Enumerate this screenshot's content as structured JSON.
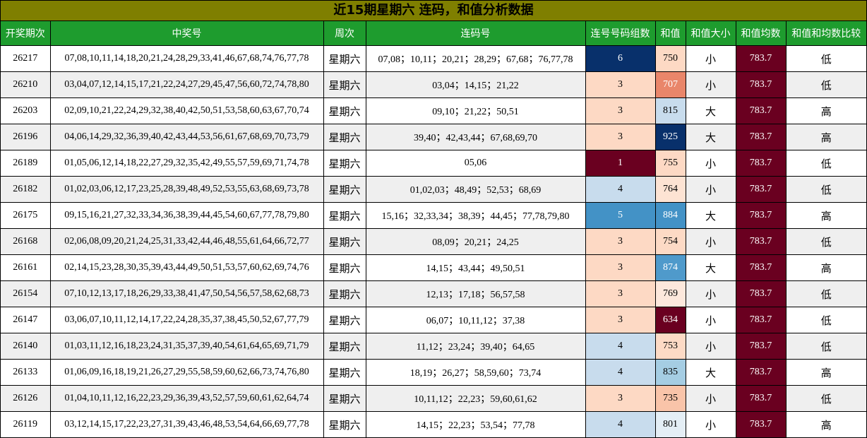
{
  "title": "近15期星期六 连码，和值分析数据",
  "headers": [
    "开奖期次",
    "中奖号",
    "周次",
    "连码号",
    "连号号码组数",
    "和值",
    "和值大小",
    "和值均数",
    "和值和均数比较"
  ],
  "colors": {
    "title_bg": "#7f7f00",
    "header_bg": "#1e9c2e",
    "avg_bg": "#6a0020"
  },
  "rows": [
    {
      "period": "26217",
      "numbers": "07,08,10,11,14,18,20,21,24,28,29,33,41,46,67,68,74,76,77,78",
      "week": "星期六",
      "consecutive": "07,08；10,11；20,21；28,29；67,68；76,77,78",
      "groups": "6",
      "sum": "750",
      "size": "小",
      "avg": "783.7",
      "compare": "低",
      "groups_color": "#08306b",
      "sum_color": "#fdd9c4"
    },
    {
      "period": "26210",
      "numbers": "03,04,07,12,14,15,17,21,22,24,27,29,45,47,56,60,72,74,78,80",
      "week": "星期六",
      "consecutive": "03,04；14,15；21,22",
      "groups": "3",
      "sum": "707",
      "size": "小",
      "avg": "783.7",
      "compare": "低",
      "groups_color": "#fdd9c4",
      "sum_color": "#e9866a"
    },
    {
      "period": "26203",
      "numbers": "02,09,10,21,22,24,29,32,38,40,42,50,51,53,58,60,63,67,70,74",
      "week": "星期六",
      "consecutive": "09,10；21,22；50,51",
      "groups": "3",
      "sum": "815",
      "size": "大",
      "avg": "783.7",
      "compare": "高",
      "groups_color": "#fdd9c4",
      "sum_color": "#c8dced"
    },
    {
      "period": "26196",
      "numbers": "04,06,14,29,32,36,39,40,42,43,44,53,56,61,67,68,69,70,73,79",
      "week": "星期六",
      "consecutive": "39,40；42,43,44；67,68,69,70",
      "groups": "3",
      "sum": "925",
      "size": "大",
      "avg": "783.7",
      "compare": "高",
      "groups_color": "#fdd9c4",
      "sum_color": "#08306b"
    },
    {
      "period": "26189",
      "numbers": "01,05,06,12,14,18,22,27,29,32,35,42,49,55,57,59,69,71,74,78",
      "week": "星期六",
      "consecutive": "05,06",
      "groups": "1",
      "sum": "755",
      "size": "小",
      "avg": "783.7",
      "compare": "低",
      "groups_color": "#6a0020",
      "sum_color": "#fdd9c4"
    },
    {
      "period": "26182",
      "numbers": "01,02,03,06,12,17,23,25,28,39,48,49,52,53,55,63,68,69,73,78",
      "week": "星期六",
      "consecutive": "01,02,03；48,49；52,53；68,69",
      "groups": "4",
      "sum": "764",
      "size": "小",
      "avg": "783.7",
      "compare": "低",
      "groups_color": "#c8dced",
      "sum_color": "#fde3d3"
    },
    {
      "period": "26175",
      "numbers": "09,15,16,21,27,32,33,34,36,38,39,44,45,54,60,67,77,78,79,80",
      "week": "星期六",
      "consecutive": "15,16；32,33,34；38,39；44,45；77,78,79,80",
      "groups": "5",
      "sum": "884",
      "size": "大",
      "avg": "783.7",
      "compare": "高",
      "groups_color": "#4392c6",
      "sum_color": "#4392c6"
    },
    {
      "period": "26168",
      "numbers": "02,06,08,09,20,21,24,25,31,33,42,44,46,48,55,61,64,66,72,77",
      "week": "星期六",
      "consecutive": "08,09；20,21；24,25",
      "groups": "3",
      "sum": "754",
      "size": "小",
      "avg": "783.7",
      "compare": "低",
      "groups_color": "#fdd9c4",
      "sum_color": "#fddac5"
    },
    {
      "period": "26161",
      "numbers": "02,14,15,23,28,30,35,39,43,44,49,50,51,53,57,60,62,69,74,76",
      "week": "星期六",
      "consecutive": "14,15；43,44；49,50,51",
      "groups": "3",
      "sum": "874",
      "size": "大",
      "avg": "783.7",
      "compare": "高",
      "groups_color": "#fdd9c4",
      "sum_color": "#4f9acb"
    },
    {
      "period": "26154",
      "numbers": "07,10,12,13,17,18,26,29,33,38,41,47,50,54,56,57,58,62,68,73",
      "week": "星期六",
      "consecutive": "12,13；17,18；56,57,58",
      "groups": "3",
      "sum": "769",
      "size": "小",
      "avg": "783.7",
      "compare": "低",
      "groups_color": "#fdd9c4",
      "sum_color": "#fde8dc"
    },
    {
      "period": "26147",
      "numbers": "03,06,07,10,11,12,14,17,22,24,28,35,37,38,45,50,52,67,77,79",
      "week": "星期六",
      "consecutive": "06,07；10,11,12；37,38",
      "groups": "3",
      "sum": "634",
      "size": "小",
      "avg": "783.7",
      "compare": "低",
      "groups_color": "#fdd9c4",
      "sum_color": "#6a0020"
    },
    {
      "period": "26140",
      "numbers": "01,03,11,12,16,18,23,24,31,35,37,39,40,54,61,64,65,69,71,79",
      "week": "星期六",
      "consecutive": "11,12；23,24；39,40；64,65",
      "groups": "4",
      "sum": "753",
      "size": "小",
      "avg": "783.7",
      "compare": "低",
      "groups_color": "#c8dced",
      "sum_color": "#fddac5"
    },
    {
      "period": "26133",
      "numbers": "01,06,09,16,18,19,21,26,27,29,55,58,59,60,62,66,73,74,76,80",
      "week": "星期六",
      "consecutive": "18,19；26,27；58,59,60；73,74",
      "groups": "4",
      "sum": "835",
      "size": "大",
      "avg": "783.7",
      "compare": "高",
      "groups_color": "#c8dced",
      "sum_color": "#a5cde3"
    },
    {
      "period": "26126",
      "numbers": "01,04,10,11,12,16,22,23,29,36,39,43,52,57,59,60,61,62,64,74",
      "week": "星期六",
      "consecutive": "10,11,12；22,23；59,60,61,62",
      "groups": "3",
      "sum": "735",
      "size": "小",
      "avg": "783.7",
      "compare": "低",
      "groups_color": "#fdd9c4",
      "sum_color": "#f9c4a9"
    },
    {
      "period": "26119",
      "numbers": "03,12,14,15,17,22,23,27,31,39,43,46,48,53,54,64,66,69,77,78",
      "week": "星期六",
      "consecutive": "14,15；22,23；53,54；77,78",
      "groups": "4",
      "sum": "801",
      "size": "小",
      "avg": "783.7",
      "compare": "高",
      "groups_color": "#c8dced",
      "sum_color": "#e4eef5"
    }
  ]
}
